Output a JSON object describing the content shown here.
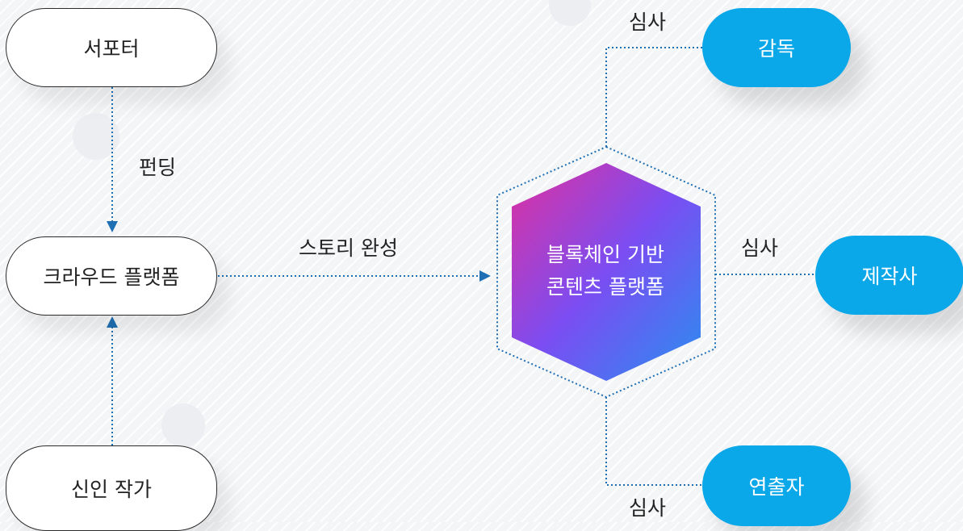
{
  "nodes": {
    "supporter": "서포터",
    "crowd_platform": "크라우드 플랫폼",
    "new_writer": "신인 작가",
    "director": "감독",
    "production": "제작사",
    "producer": "연출자"
  },
  "center": {
    "line1": "블록체인 기반",
    "line2": "콘텐츠 플랫폼"
  },
  "edge_labels": {
    "funding": "펀딩",
    "story_complete": "스토리 완성",
    "review_top": "심사",
    "review_right": "심사",
    "review_bottom": "심사"
  },
  "colors": {
    "line": "#1e6fb3",
    "accent_blue": "#0aa7e9",
    "hex_gradient_start": "#e0309e",
    "hex_gradient_mid": "#7b4df2",
    "hex_gradient_end": "#2a8ef0"
  }
}
